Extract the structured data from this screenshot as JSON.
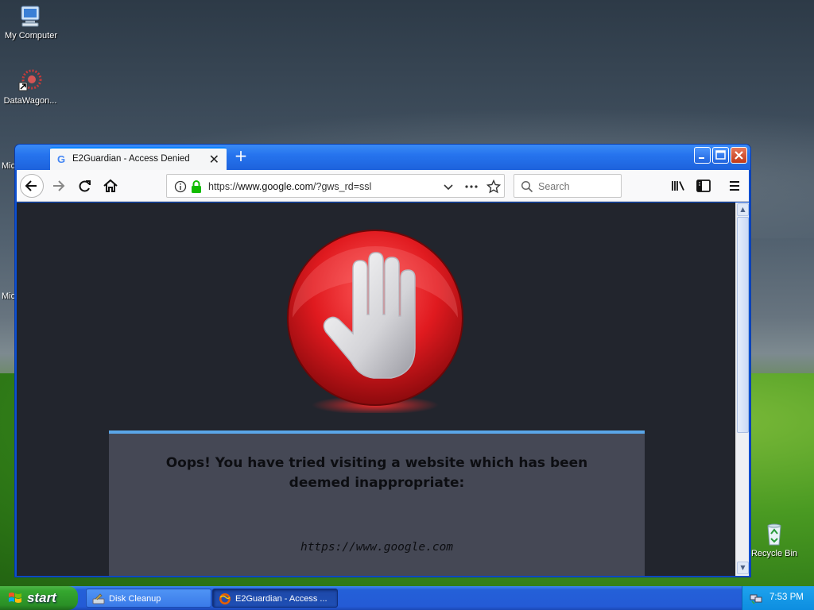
{
  "desktop": {
    "icons": [
      {
        "label": "My Computer"
      },
      {
        "label": "DataWagon..."
      },
      {
        "label": "Recycle Bin"
      }
    ],
    "partial_labels": [
      "Mic",
      "Mic"
    ]
  },
  "browser": {
    "tab": {
      "favicon": "G",
      "title": "E2Guardian - Access Denied",
      "close": "✕"
    },
    "new_tab": "+",
    "url": {
      "scheme": "https://",
      "host": "www.google.com",
      "path": "/?gws_rd=ssl"
    },
    "search": {
      "placeholder": "Search"
    }
  },
  "page": {
    "message": "Oops! You have tried visiting a website which has been deemed inappropriate:",
    "blocked_url": "https://www.google.com"
  },
  "taskbar": {
    "start_label": "start",
    "tasks": [
      {
        "label": "Disk Cleanup",
        "active": false
      },
      {
        "label": "E2Guardian - Access ...",
        "active": true
      }
    ],
    "clock": "7:53 PM"
  },
  "colors": {
    "accent": "#0a84ff",
    "stop_red": "#d7161b",
    "page_bg": "#22252d",
    "box_bg": "#454855",
    "box_border": "#5aa6e8"
  }
}
